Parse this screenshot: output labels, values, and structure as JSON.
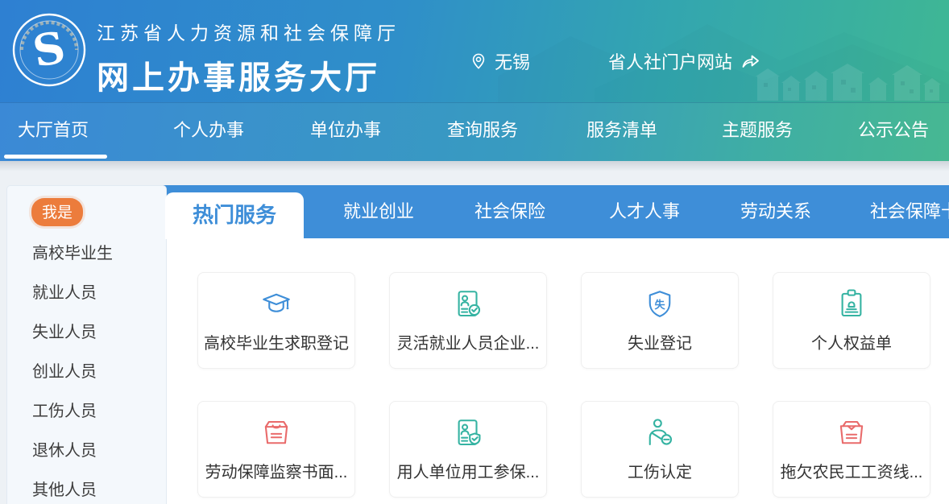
{
  "colors": {
    "header_gradient_left": "#2E80D2",
    "header_gradient_right": "#3FB794",
    "nav_blue": "#3B89D6",
    "tabstrip_blue": "#3E8ED8",
    "badge_orange": "#EC7C3C",
    "icon_blue": "#3E8ED8",
    "icon_teal": "#35B3A2",
    "icon_red": "#E96B6B",
    "content_bg": "#edf1f5",
    "sidebar_bg": "#f4f8fc"
  },
  "header": {
    "org_name": "江苏省人力资源和社会保障厅",
    "hall_title": "网上办事服务大厅",
    "location": "无锡",
    "location_icon": "map-pin-icon",
    "portal_link": "省人社门户网站",
    "portal_icon": "external-share-arrow-icon",
    "logo_icon": "provincial-hrss-seal-logo"
  },
  "nav": {
    "items": [
      {
        "label": "大厅首页",
        "active": true
      },
      {
        "label": "个人办事",
        "active": false
      },
      {
        "label": "单位办事",
        "active": false
      },
      {
        "label": "查询服务",
        "active": false
      },
      {
        "label": "服务清单",
        "active": false
      },
      {
        "label": "主题服务",
        "active": false
      },
      {
        "label": "公示公告",
        "active": false
      }
    ]
  },
  "sidebar": {
    "badge": "我是",
    "items": [
      "高校毕业生",
      "就业人员",
      "失业人员",
      "创业人员",
      "工伤人员",
      "退休人员",
      "其他人员"
    ]
  },
  "tabs": {
    "items": [
      {
        "label": "热门服务",
        "active": true
      },
      {
        "label": "就业创业",
        "active": false
      },
      {
        "label": "社会保险",
        "active": false
      },
      {
        "label": "人才人事",
        "active": false
      },
      {
        "label": "劳动关系",
        "active": false
      },
      {
        "label": "社会保障卡",
        "active": false
      }
    ]
  },
  "services": {
    "cards": [
      {
        "label": "高校毕业生求职登记",
        "icon": "graduation-cap-icon",
        "color": "blue"
      },
      {
        "label": "灵活就业人员企业...",
        "icon": "id-document-person-icon",
        "color": "teal"
      },
      {
        "label": "失业登记",
        "icon": "shield-shi-icon",
        "color": "blue"
      },
      {
        "label": "个人权益单",
        "icon": "clipboard-seal-icon",
        "color": "teal"
      },
      {
        "label": "劳动保障监察书面...",
        "icon": "open-archive-box-icon",
        "color": "red"
      },
      {
        "label": "用人单位用工参保...",
        "icon": "id-document-shield-check-icon",
        "color": "teal"
      },
      {
        "label": "工伤认定",
        "icon": "injured-person-icon",
        "color": "teal"
      },
      {
        "label": "拖欠农民工工资线...",
        "icon": "carton-box-icon",
        "color": "red"
      }
    ]
  }
}
